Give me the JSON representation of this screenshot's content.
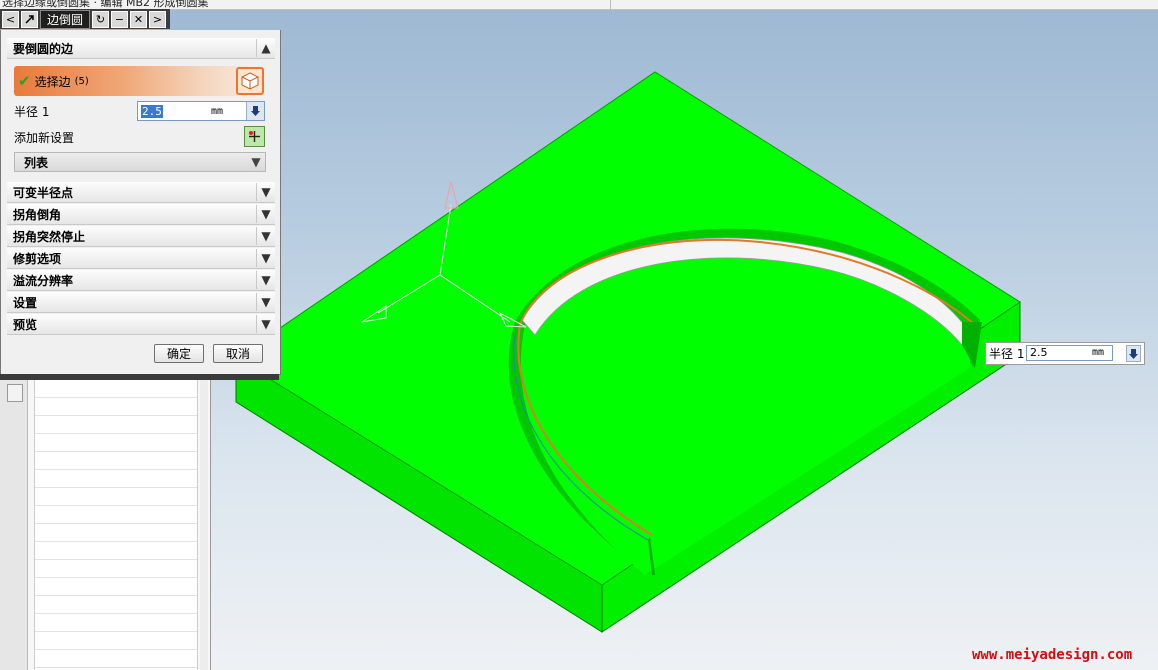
{
  "topbar": {
    "cut_text": "选择边缘或倒圆集 · 编辑 MB2 形成倒圆集"
  },
  "dialog_bar": {
    "back": "<",
    "tool_icon": "edge-blend-icon",
    "title": "边倒圆",
    "reset": "↻",
    "minimize": "−",
    "close": "✕",
    "next": ">"
  },
  "panel": {
    "section_edges": "要倒圆的边",
    "select_edge_label": "选择边",
    "select_edge_count": "(5)",
    "radius_label": "半径 1",
    "radius_value": "2.5",
    "radius_unit": "mm",
    "add_new_set": "添加新设置",
    "list_label": "列表",
    "sections": [
      "可变半径点",
      "拐角倒角",
      "拐角突然停止",
      "修剪选项",
      "溢流分辨率",
      "设置",
      "预览"
    ],
    "ok": "确定",
    "cancel": "取消"
  },
  "float_input": {
    "label": "半径 1",
    "value": "2.5",
    "unit": "mm"
  },
  "watermark": "www.meiyadesign.com",
  "colors": {
    "model_top": "#00ff00",
    "model_side": "#00e600",
    "edge_highlight": "#e07a28",
    "accent": "#e8782f"
  }
}
